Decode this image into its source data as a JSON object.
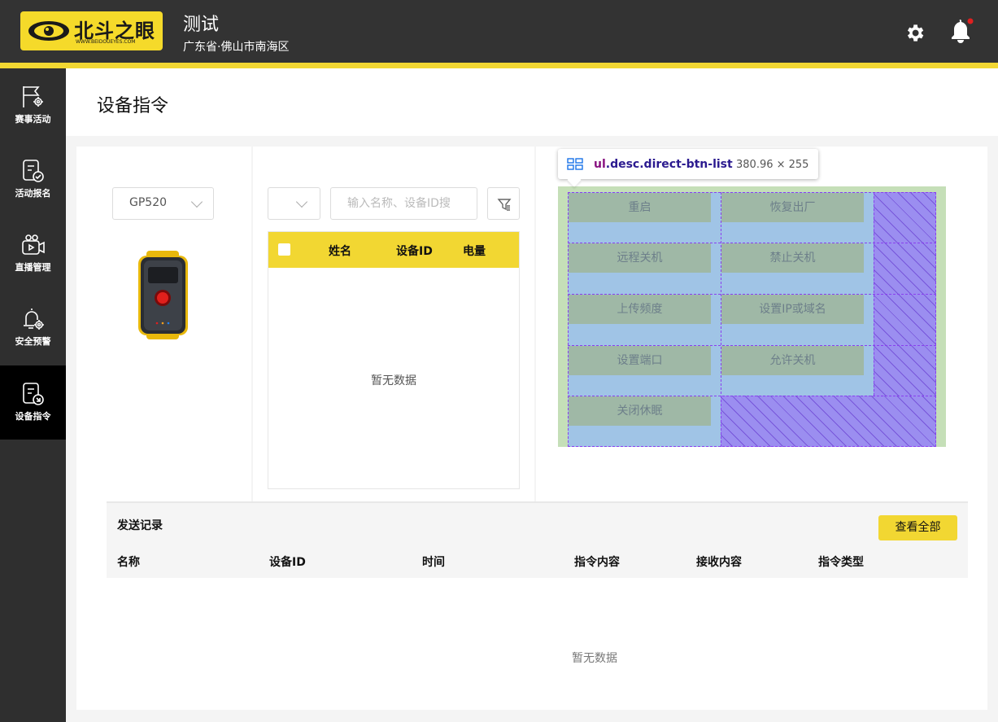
{
  "header": {
    "logo_text": "北斗之眼",
    "logo_url": "WWW.BEIDOUEYES.COM",
    "title": "测试",
    "subtitle": "广东省·佛山市南海区",
    "colors": {
      "bar": "#333333",
      "accent": "#f2d732",
      "notify_dot": "#e02020"
    }
  },
  "sidebar": {
    "items": [
      {
        "label": "赛事活动",
        "icon": "flag-gear-icon"
      },
      {
        "label": "活动报名",
        "icon": "signup-doc-icon"
      },
      {
        "label": "直播管理",
        "icon": "video-camera-icon"
      },
      {
        "label": "安全预警",
        "icon": "alarm-bell-gear-icon"
      },
      {
        "label": "设备指令",
        "icon": "command-doc-icon",
        "active": true
      }
    ]
  },
  "page": {
    "title": "设备指令"
  },
  "device": {
    "model": "GP520"
  },
  "device_list": {
    "filter_value": "",
    "search_placeholder": "输入名称、设备ID搜",
    "columns": [
      "姓名",
      "设备ID",
      "电量"
    ],
    "empty_text": "暂无数据"
  },
  "devtools": {
    "selector_tag": "ul",
    "selector_classes": ".desc.direct-btn-list",
    "dimensions": "380.96 × 255"
  },
  "commands": [
    "重启",
    "恢复出厂",
    "远程关机",
    "禁止关机",
    "上传频度",
    "设置IP或域名",
    "设置端口",
    "允许关机",
    "关闭休眠"
  ],
  "records": {
    "title": "发送记录",
    "view_all_label": "查看全部",
    "columns": [
      "名称",
      "设备ID",
      "时间",
      "指令内容",
      "接收内容",
      "指令类型"
    ],
    "empty_text": "暂无数据"
  }
}
